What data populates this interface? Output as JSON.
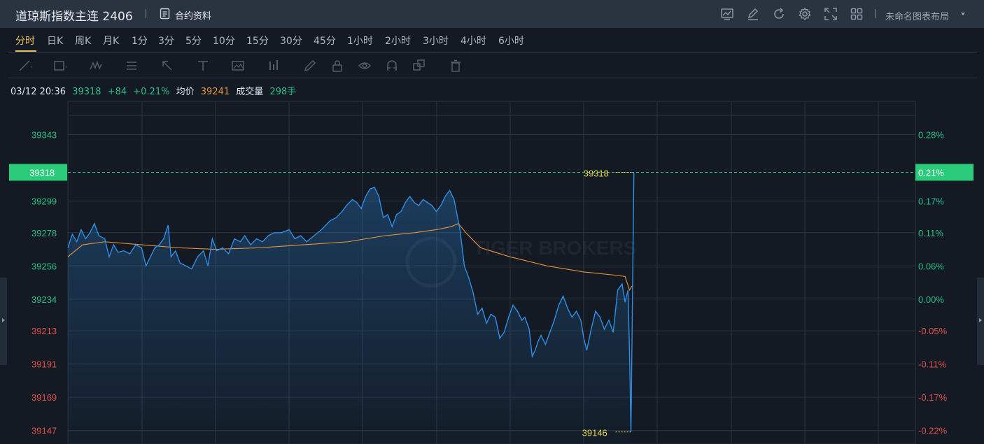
{
  "header": {
    "title": "道琼斯指数主连 2406",
    "contract_info_label": "合约资料",
    "layout_label": "未命名图表布局",
    "icons": [
      "chart-icon",
      "draw-icon",
      "refresh-icon",
      "settings-icon",
      "fullscreen-icon",
      "grid-layout-icon"
    ]
  },
  "tabs": {
    "items": [
      "分时",
      "日K",
      "周K",
      "月K",
      "1分",
      "3分",
      "5分",
      "10分",
      "15分",
      "30分",
      "45分",
      "1小时",
      "2小时",
      "3小时",
      "4小时",
      "6小时"
    ],
    "active": "分时"
  },
  "toolbar": {
    "tools": [
      "line-tool-icon",
      "rect-tool-icon",
      "wave-tool-icon",
      "fib-tool-icon",
      "arrow-tool-icon",
      "text-tool-icon",
      "image-tool-icon",
      "measure-tool-icon",
      "pencil-icon",
      "lock-icon",
      "eye-icon",
      "magnet-icon",
      "clone-icon",
      "trash-icon"
    ]
  },
  "info": {
    "datetime": "03/12 20:36",
    "price": "39318",
    "change": "+84",
    "change_pct": "+0.21%",
    "avg_label": "均价",
    "avg_value": "39241",
    "volume_label": "成交量",
    "volume_value": "298手"
  },
  "colors": {
    "up": "#27c08a",
    "down": "#e2504e",
    "price_line": "#2f8ee6",
    "avg_line": "#e8943a",
    "highlight": "#2bcb7c",
    "marker": "#e8d84a",
    "watermark": "TIGER BROKERS"
  },
  "chart_data": {
    "type": "line",
    "series": [],
    "left_ticks": [
      "39343",
      "39318",
      "39299",
      "39278",
      "39256",
      "39234",
      "39213",
      "39191",
      "39169",
      "39147"
    ],
    "right_ticks": [
      "0.28%",
      "0.21%",
      "0.17%",
      "0.11%",
      "0.06%",
      "0.00%",
      "-0.05%",
      "-0.11%",
      "-0.17%",
      "-0.22%"
    ],
    "current_price_label": "39318",
    "current_pct_label": "0.21%",
    "high_marker": "39318",
    "low_marker": "39146",
    "ylim": [
      39138,
      39365
    ],
    "prev_close": 39234,
    "price_points": [
      [
        0,
        39268
      ],
      [
        6,
        39277
      ],
      [
        12,
        39272
      ],
      [
        18,
        39280
      ],
      [
        24,
        39274
      ],
      [
        30,
        39278
      ],
      [
        36,
        39284
      ],
      [
        42,
        39276
      ],
      [
        50,
        39274
      ],
      [
        56,
        39262
      ],
      [
        62,
        39270
      ],
      [
        68,
        39265
      ],
      [
        76,
        39266
      ],
      [
        84,
        39264
      ],
      [
        92,
        39270
      ],
      [
        100,
        39268
      ],
      [
        106,
        39256
      ],
      [
        112,
        39262
      ],
      [
        118,
        39268
      ],
      [
        124,
        39270
      ],
      [
        130,
        39274
      ],
      [
        136,
        39283
      ],
      [
        140,
        39262
      ],
      [
        146,
        39266
      ],
      [
        152,
        39258
      ],
      [
        160,
        39256
      ],
      [
        168,
        39254
      ],
      [
        176,
        39262
      ],
      [
        184,
        39266
      ],
      [
        190,
        39256
      ],
      [
        196,
        39274
      ],
      [
        202,
        39266
      ],
      [
        210,
        39268
      ],
      [
        218,
        39264
      ],
      [
        226,
        39274
      ],
      [
        234,
        39272
      ],
      [
        240,
        39276
      ],
      [
        248,
        39270
      ],
      [
        256,
        39274
      ],
      [
        264,
        39272
      ],
      [
        272,
        39276
      ],
      [
        280,
        39278
      ],
      [
        290,
        39278
      ],
      [
        300,
        39280
      ],
      [
        308,
        39274
      ],
      [
        316,
        39276
      ],
      [
        324,
        39272
      ],
      [
        334,
        39276
      ],
      [
        344,
        39280
      ],
      [
        356,
        39286
      ],
      [
        364,
        39288
      ],
      [
        372,
        39292
      ],
      [
        378,
        39296
      ],
      [
        386,
        39300
      ],
      [
        392,
        39298
      ],
      [
        398,
        39294
      ],
      [
        404,
        39302
      ],
      [
        410,
        39307
      ],
      [
        416,
        39308
      ],
      [
        422,
        39302
      ],
      [
        428,
        39288
      ],
      [
        434,
        39290
      ],
      [
        440,
        39282
      ],
      [
        446,
        39290
      ],
      [
        452,
        39292
      ],
      [
        458,
        39298
      ],
      [
        464,
        39302
      ],
      [
        470,
        39298
      ],
      [
        476,
        39296
      ],
      [
        482,
        39300
      ],
      [
        488,
        39298
      ],
      [
        494,
        39296
      ],
      [
        500,
        39292
      ],
      [
        506,
        39296
      ],
      [
        512,
        39302
      ],
      [
        518,
        39306
      ],
      [
        524,
        39300
      ],
      [
        528,
        39290
      ],
      [
        532,
        39280
      ],
      [
        538,
        39256
      ],
      [
        544,
        39248
      ],
      [
        550,
        39238
      ],
      [
        556,
        39224
      ],
      [
        562,
        39228
      ],
      [
        568,
        39218
      ],
      [
        574,
        39224
      ],
      [
        580,
        39222
      ],
      [
        586,
        39208
      ],
      [
        592,
        39212
      ],
      [
        598,
        39222
      ],
      [
        604,
        39230
      ],
      [
        610,
        39226
      ],
      [
        616,
        39220
      ],
      [
        620,
        39222
      ],
      [
        626,
        39214
      ],
      [
        630,
        39196
      ],
      [
        634,
        39200
      ],
      [
        638,
        39206
      ],
      [
        642,
        39210
      ],
      [
        648,
        39204
      ],
      [
        654,
        39212
      ],
      [
        660,
        39220
      ],
      [
        666,
        39230
      ],
      [
        672,
        39236
      ],
      [
        678,
        39228
      ],
      [
        684,
        39222
      ],
      [
        690,
        39226
      ],
      [
        696,
        39220
      ],
      [
        700,
        39208
      ],
      [
        704,
        39200
      ],
      [
        710,
        39214
      ],
      [
        716,
        39226
      ],
      [
        722,
        39222
      ],
      [
        728,
        39214
      ],
      [
        734,
        39220
      ],
      [
        740,
        39212
      ],
      [
        746,
        39240
      ],
      [
        752,
        39244
      ],
      [
        756,
        39232
      ],
      [
        760,
        39240
      ],
      [
        762,
        39200
      ],
      [
        764,
        39146
      ],
      [
        766,
        39230
      ],
      [
        768,
        39318
      ]
    ],
    "avg_points": [
      [
        0,
        39262
      ],
      [
        20,
        39270
      ],
      [
        50,
        39272
      ],
      [
        100,
        39270
      ],
      [
        150,
        39268
      ],
      [
        200,
        39267
      ],
      [
        260,
        39268
      ],
      [
        320,
        39270
      ],
      [
        380,
        39272
      ],
      [
        430,
        39276
      ],
      [
        470,
        39278
      ],
      [
        500,
        39280
      ],
      [
        520,
        39282
      ],
      [
        530,
        39284
      ],
      [
        540,
        39278
      ],
      [
        560,
        39268
      ],
      [
        600,
        39262
      ],
      [
        650,
        39256
      ],
      [
        700,
        39252
      ],
      [
        740,
        39250
      ],
      [
        756,
        39249
      ],
      [
        762,
        39240
      ],
      [
        766,
        39243
      ]
    ]
  }
}
